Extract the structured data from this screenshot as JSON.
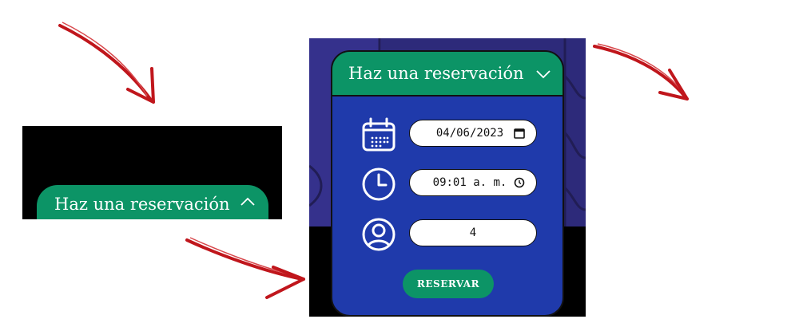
{
  "collapsed_widget": {
    "title": "Haz una reservación",
    "toggle_icon": "chevron-up-icon"
  },
  "expanded_widget": {
    "title": "Haz una reservación",
    "toggle_icon": "chevron-down-icon",
    "date_field": {
      "icon": "calendar-icon",
      "value": "04/06/2023",
      "picker_icon": "calendar-small-icon"
    },
    "time_field": {
      "icon": "clock-icon",
      "value": "09:01 a. m.",
      "picker_icon": "clock-small-icon"
    },
    "guests_field": {
      "icon": "user-circle-icon",
      "value": "4"
    },
    "submit_label": "RESERVAR"
  },
  "colors": {
    "green": "#0c9466",
    "blue": "#1f3aab",
    "navy": "#2d2a7a",
    "arrow_red": "#c0161c"
  }
}
